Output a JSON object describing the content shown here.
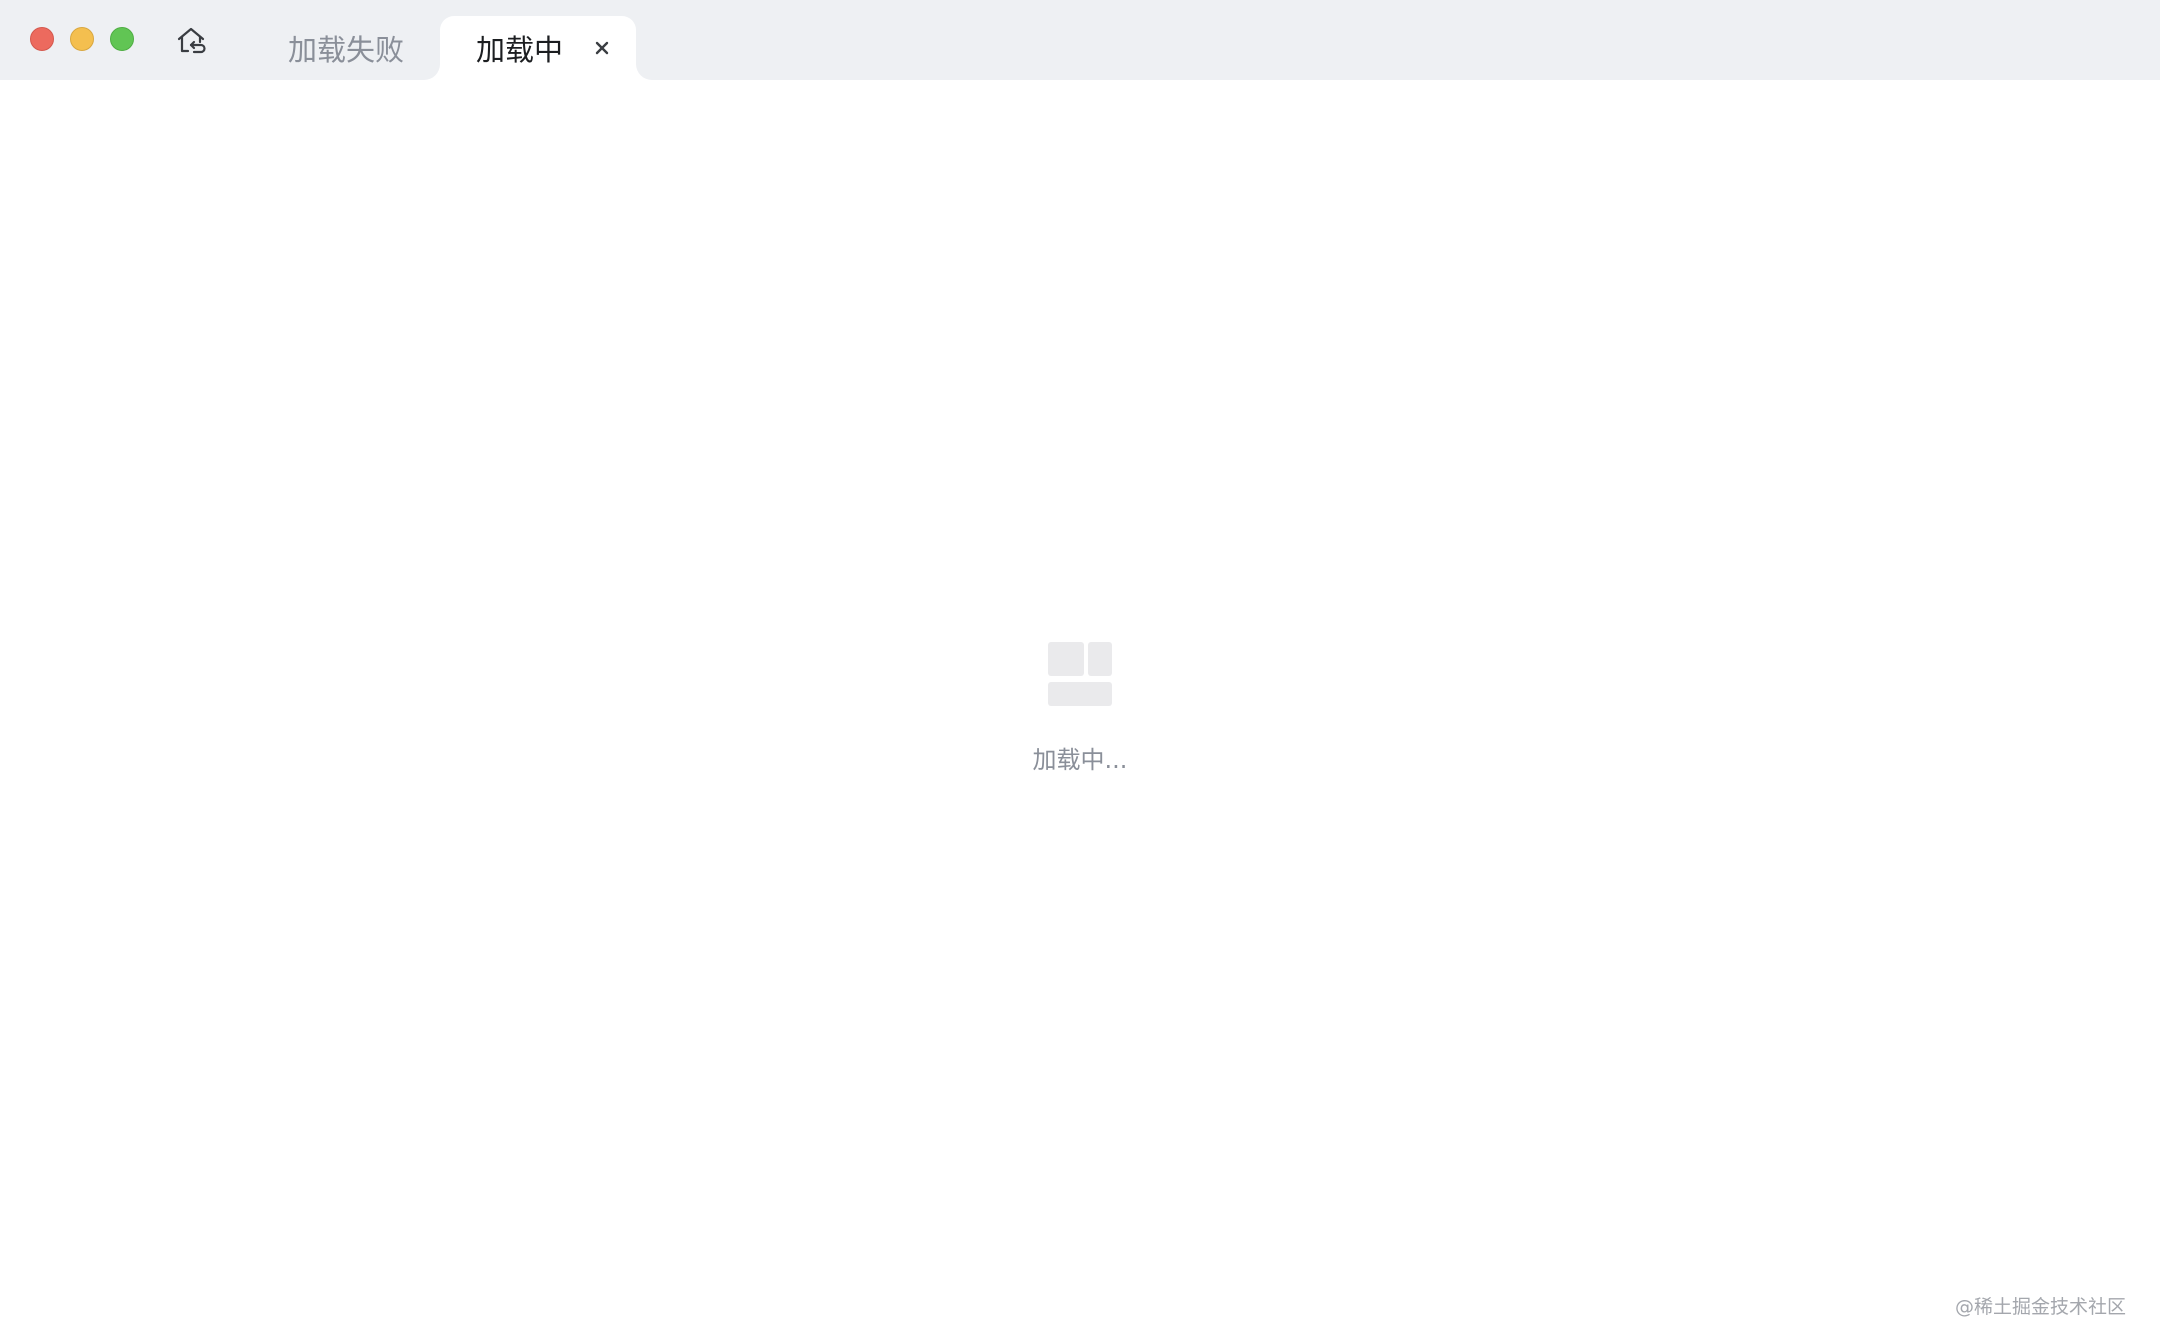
{
  "window": {
    "controls": [
      "close",
      "minimize",
      "maximize"
    ],
    "home_icon": "home-back-icon"
  },
  "tabs": [
    {
      "label": "加载失败",
      "active": false
    },
    {
      "label": "加载中",
      "active": true,
      "close_glyph": "×"
    }
  ],
  "content": {
    "loading_icon": "skeleton-layout-icon",
    "loading_text": "加载中..."
  },
  "watermark": "@稀土掘金技术社区",
  "colors": {
    "titlebar_bg": "#eef0f3",
    "content_bg": "#ffffff",
    "muted_text": "#8a8f99",
    "close_red": "#ec6a5e",
    "minimize_yellow": "#f4bf4f",
    "maximize_green": "#61c554"
  }
}
